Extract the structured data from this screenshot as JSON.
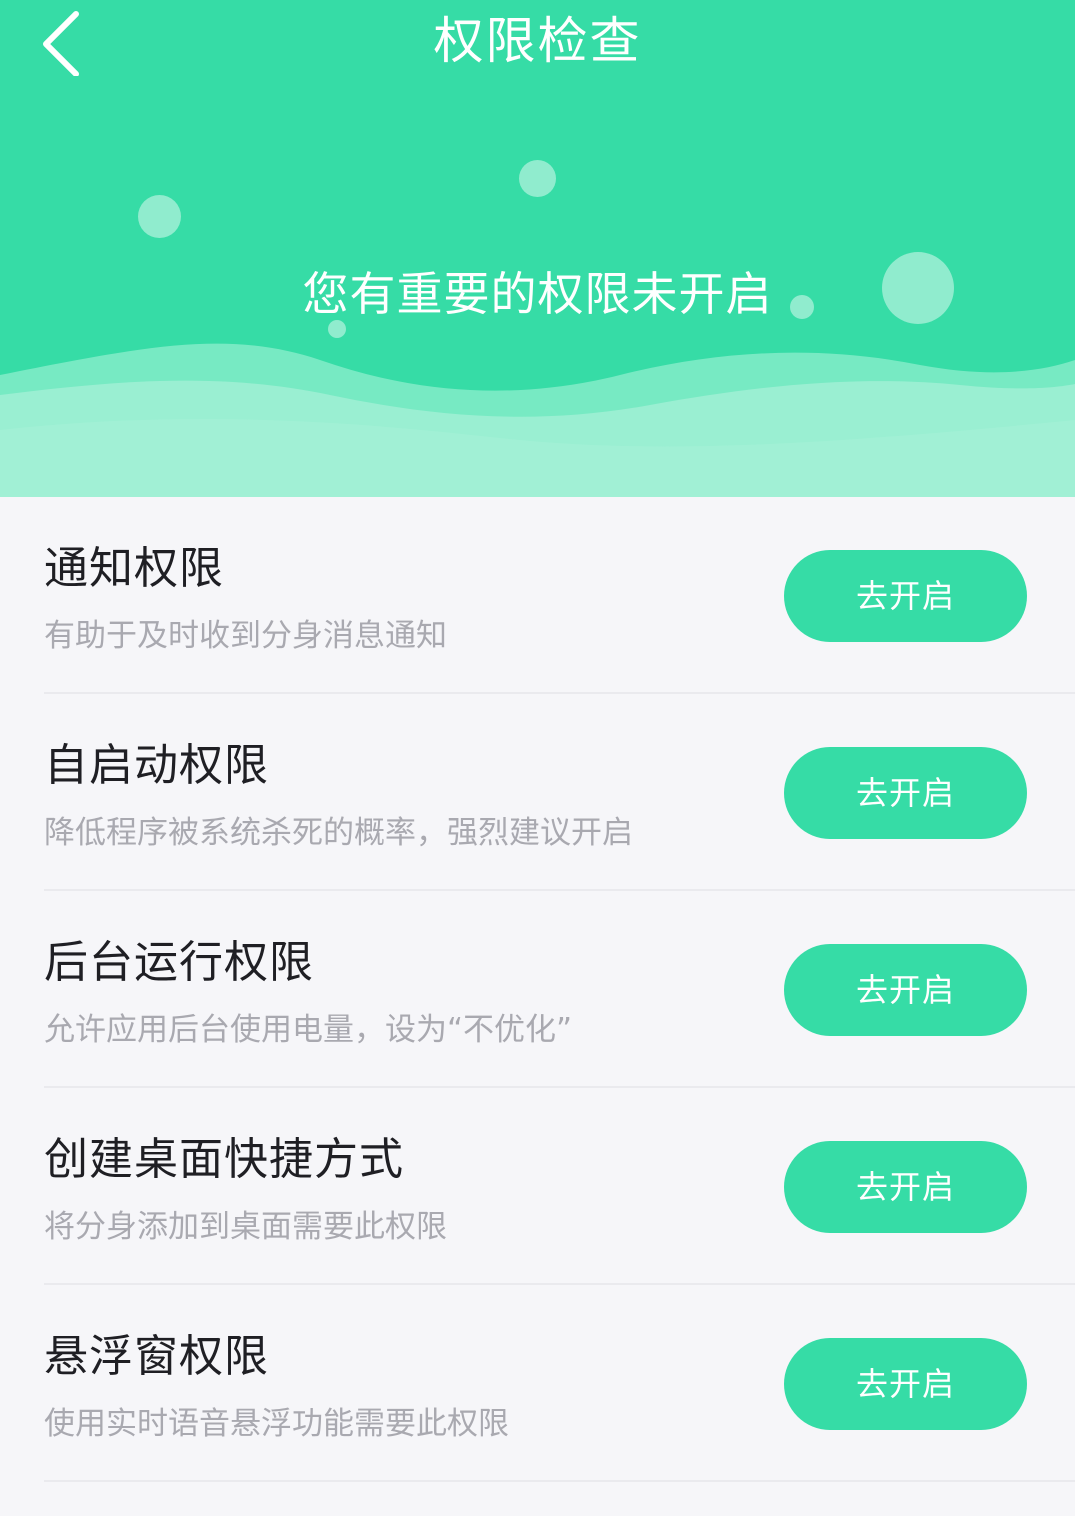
{
  "header": {
    "title": "权限检查",
    "banner_text": "您有重要的权限未开启",
    "accent_color": "#36dca6",
    "back_icon": "chevron-left-icon"
  },
  "permissions": [
    {
      "title": "通知权限",
      "description": "有助于及时收到分身消息通知",
      "button_label": "去开启"
    },
    {
      "title": "自启动权限",
      "description": "降低程序被系统杀死的概率，强烈建议开启",
      "button_label": "去开启"
    },
    {
      "title": "后台运行权限",
      "description": "允许应用后台使用电量，设为“不优化”",
      "button_label": "去开启"
    },
    {
      "title": "创建桌面快捷方式",
      "description": "将分身添加到桌面需要此权限",
      "button_label": "去开启"
    },
    {
      "title": "悬浮窗权限",
      "description": "使用实时语音悬浮功能需要此权限",
      "button_label": "去开启"
    }
  ]
}
